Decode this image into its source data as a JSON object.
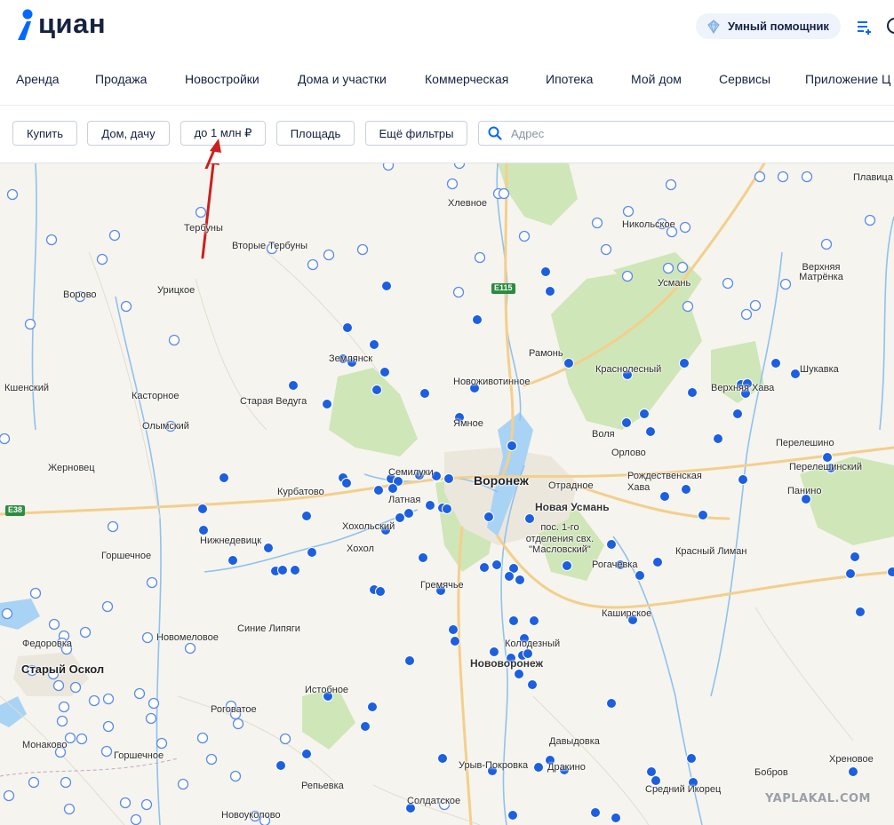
{
  "header": {
    "logo_text": "циан",
    "assistant_label": "Умный помощник",
    "nav": [
      "Аренда",
      "Продажа",
      "Новостройки",
      "Дома и участки",
      "Коммерческая",
      "Ипотека",
      "Мой дом",
      "Сервисы",
      "Приложение Ц"
    ]
  },
  "filters": {
    "deal": "Купить",
    "type": "Дом, дачу",
    "price": "до 1 млн ₽",
    "area": "Площадь",
    "more": "Ещё фильтры",
    "address_placeholder": "Адрес"
  },
  "map": {
    "city_labels": [
      "Воронеж",
      "Старый Оскол"
    ],
    "town_labels": [
      "Нововоронеж",
      "Семилуки",
      "Рамонь",
      "Новая Усмань"
    ],
    "place_labels": [
      "Хлевное",
      "Тербуны",
      "Вторые Тербуны",
      "Урицкое",
      "Ворово",
      "Никольское",
      "Усмань",
      "Верхняя Матрёнка",
      "Землянск",
      "Краснолесный",
      "Верхняя Хава",
      "Шукавка",
      "Кшенский",
      "Касторное",
      "Старая Ведуга",
      "Новоживотинное",
      "Ямное",
      "Олымский",
      "Воля",
      "Перелешино",
      "Жерновец",
      "Орлово",
      "Перелешинский",
      "Курбатово",
      "Латная",
      "Отрадное",
      "Рождественская Хава",
      "Панино",
      "Хохольский",
      "Хохол",
      "пос. 1-го отделения свх. \"Масловский\"",
      "Рогачевка",
      "Красный Лиман",
      "Нижнедевицк",
      "Горшечное",
      "Гремячье",
      "Каширское",
      "Федоровка",
      "Новомеловое",
      "Синие Липяги",
      "Колодезный",
      "Истобное",
      "Репьевка",
      "Роговатое",
      "Монаково",
      "Горшечное",
      "Давыдовка",
      "Урыв-Покровка",
      "Дракино",
      "Бобров",
      "Хреновое",
      "Средний Икорец",
      "Солдатское",
      "Новоуколово",
      "Плавица"
    ],
    "road_labels": [
      "E115",
      "E38"
    ],
    "watermark": "YAPLAKAL.COM",
    "colors": {
      "water": "#a9d3f5",
      "forest": "#cfe6b8",
      "land": "#f6f4ee",
      "road": "#f3cf8c",
      "listing_filled": "#1c5fe0",
      "listing_outline": "#5b8cea",
      "arrow": "#cc1f1f"
    }
  }
}
